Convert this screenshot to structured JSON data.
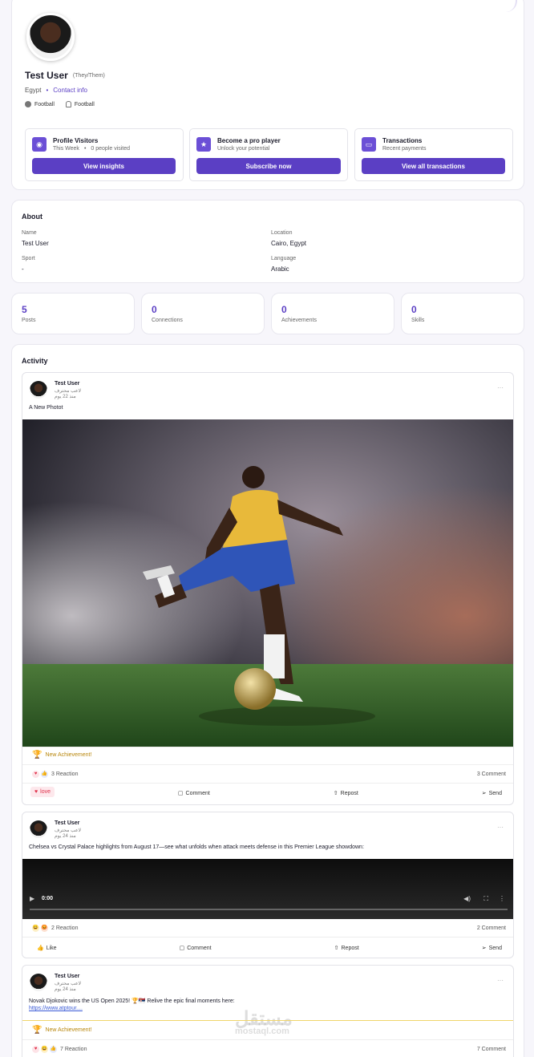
{
  "profile": {
    "name": "Test User",
    "pronouns": "(They/Them)",
    "country": "Egypt",
    "contact_link": "Contact info",
    "tags": [
      "Football",
      "Football"
    ]
  },
  "promo_cards": [
    {
      "title": "Profile Visitors",
      "subtitle_a": "This Week",
      "subtitle_b": "0 people visited",
      "button": "View insights",
      "icon": "eye-icon"
    },
    {
      "title": "Become a pro player",
      "subtitle_a": "Unlock your potential",
      "button": "Subscribe now",
      "icon": "star-icon"
    },
    {
      "title": "Transactions",
      "subtitle_a": "Recent payments",
      "button": "View all transactions",
      "icon": "wallet-icon"
    }
  ],
  "about": {
    "heading": "About",
    "fields": [
      {
        "label": "Name",
        "value": "Test User"
      },
      {
        "label": "Location",
        "value": "Cairo, Egypt"
      },
      {
        "label": "Sport",
        "value": "-"
      },
      {
        "label": "Language",
        "value": "Arabic"
      }
    ]
  },
  "stats": [
    {
      "value": "5",
      "label": "Posts"
    },
    {
      "value": "0",
      "label": "Connections"
    },
    {
      "value": "0",
      "label": "Achievements"
    },
    {
      "value": "0",
      "label": "Skills"
    }
  ],
  "activity": {
    "heading": "Activity",
    "posts": [
      {
        "author": "Test User",
        "role": "لاعب محترف",
        "time": "منذ 22 يوم",
        "text": "A New Photot",
        "achievement": "New Achievement!",
        "reactions": "3 Reaction",
        "comments": "3 Comment",
        "actions": [
          "love",
          "Comment",
          "Repost",
          "Send"
        ]
      },
      {
        "author": "Test User",
        "role": "لاعب محترف",
        "time": "منذ 24 يوم",
        "text": "Chelsea vs Crystal Palace highlights from August 17—see what unfolds when attack meets defense in this Premier League showdown:",
        "video_time": "0:00",
        "reactions": "2 Reaction",
        "comments": "2 Comment",
        "actions": [
          "Like",
          "Comment",
          "Repost",
          "Send"
        ]
      },
      {
        "author": "Test User",
        "role": "لاعب محترف",
        "time": "منذ 24 يوم",
        "text": "Novak Djokovic wins the US Open 2025! 🏆🇷🇸 Relive the epic final moments here:",
        "link": "https://www.atptour....",
        "achievement": "New Achievement!",
        "reactions": "7 Reaction",
        "comments": "7 Comment"
      }
    ]
  },
  "watermark": {
    "arabic": "مستقل",
    "latin": "mostaql.com"
  },
  "colors": {
    "accent": "#5b3fc4",
    "achievement": "#b8860b",
    "love": "#e0314b"
  }
}
